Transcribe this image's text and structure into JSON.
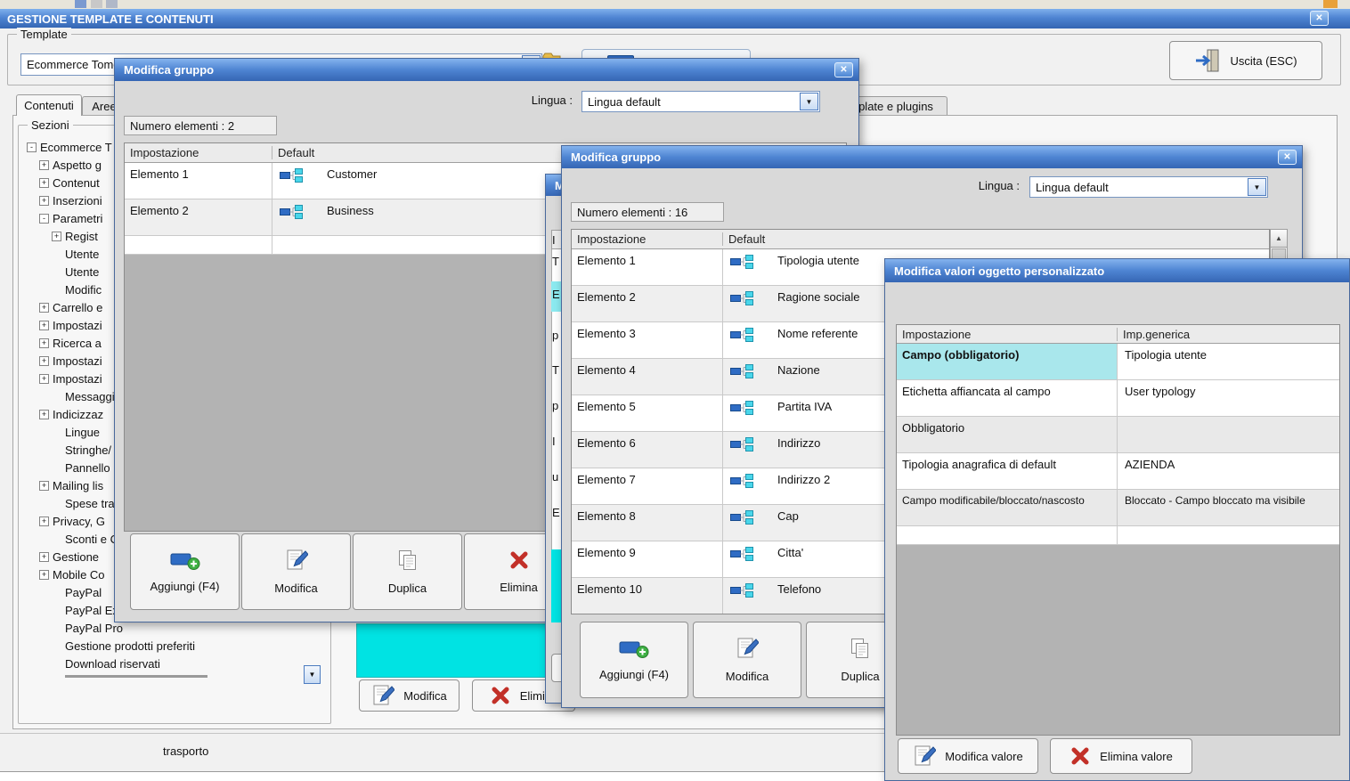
{
  "glyphs": {
    "close": "✕",
    "down": "▼",
    "up": "▲"
  },
  "app": {
    "title": "GESTIONE TEMPLATE E CONTENUTI"
  },
  "template_box": {
    "label": "Template",
    "combo_value": "Ecommerce Tome",
    "exit_button": "Uscita (ESC)"
  },
  "tabs": {
    "contenuti": "Contenuti",
    "aree": "Aree",
    "plugins": "plate e plugins"
  },
  "sezioni": {
    "label": "Sezioni",
    "tree": [
      {
        "exp": "-",
        "label": "Ecommerce T"
      },
      {
        "exp": "+",
        "label": "Aspetto g"
      },
      {
        "exp": "+",
        "label": "Contenut"
      },
      {
        "exp": "+",
        "label": "Inserzioni"
      },
      {
        "exp": "-",
        "label": "Parametri"
      },
      {
        "exp": "+",
        "label": "Regist"
      },
      {
        "label": "Utente"
      },
      {
        "label": "Utente"
      },
      {
        "label": "Modific"
      },
      {
        "exp": "+",
        "label": "Carrello e"
      },
      {
        "exp": "+",
        "label": "Impostazi"
      },
      {
        "exp": "+",
        "label": "Ricerca a"
      },
      {
        "exp": "+",
        "label": "Impostazi"
      },
      {
        "exp": "+",
        "label": "Impostazi"
      },
      {
        "label": "Messaggi"
      },
      {
        "exp": "+",
        "label": "Indicizzaz"
      },
      {
        "label": "Lingue"
      },
      {
        "label": "Stringhe/"
      },
      {
        "label": "Pannello"
      },
      {
        "exp": "+",
        "label": "Mailing lis"
      },
      {
        "label": "Spese tra"
      },
      {
        "exp": "+",
        "label": "Privacy, G"
      },
      {
        "label": "Sconti e C"
      },
      {
        "exp": "+",
        "label": "Gestione"
      },
      {
        "exp": "+",
        "label": "Mobile Co"
      },
      {
        "label": "PayPal"
      },
      {
        "label": "PayPal Ex"
      },
      {
        "label": "PayPal Pro"
      },
      {
        "label": "Gestione prodotti preferiti"
      },
      {
        "label": "Download riservati"
      }
    ]
  },
  "content": {
    "modifica_button": "Modifica",
    "elimina_button": "Elimina",
    "footer_text": "trasporto"
  },
  "dialog_a": {
    "title": "Modifica gruppo",
    "lingua_label": "Lingua :",
    "lingua_value": "Lingua default",
    "numero": "Numero elementi : 2",
    "col_impostazione": "Impostazione",
    "col_default": "Default",
    "rows": [
      {
        "name": "Elemento 1",
        "value": "Customer"
      },
      {
        "name": "Elemento 2",
        "value": "Business"
      }
    ],
    "btn_aggiungi": "Aggiungi (F4)",
    "btn_modifica": "Modifica",
    "btn_duplica": "Duplica",
    "btn_elimina": "Elimina"
  },
  "dialog_b": {
    "title": "Modifica gruppo",
    "lingua_label": "Lingua :",
    "lingua_value": "Lingua default",
    "numero": "Numero elementi : 16",
    "col_impostazione": "Impostazione",
    "col_default": "Default",
    "rows": [
      {
        "name": "Elemento 1",
        "value": "Tipologia utente"
      },
      {
        "name": "Elemento 2",
        "value": "Ragione sociale"
      },
      {
        "name": "Elemento 3",
        "value": "Nome referente"
      },
      {
        "name": "Elemento 4",
        "value": "Nazione"
      },
      {
        "name": "Elemento 5",
        "value": "Partita IVA"
      },
      {
        "name": "Elemento 6",
        "value": "Indirizzo"
      },
      {
        "name": "Elemento 7",
        "value": "Indirizzo 2"
      },
      {
        "name": "Elemento 8",
        "value": "Cap"
      },
      {
        "name": "Elemento 9",
        "value": "Citta'"
      },
      {
        "name": "Elemento 10",
        "value": "Telefono"
      }
    ],
    "btn_aggiungi": "Aggiungi (F4)",
    "btn_modifica": "Modifica",
    "btn_duplica": "Duplica"
  },
  "dialog_hidden": {
    "title_fragment": "M",
    "fragments": [
      "I",
      "T",
      "E",
      "p",
      "T",
      "p",
      "I",
      "u",
      "E"
    ]
  },
  "dialog_d": {
    "title": "Modifica valori oggetto personalizzato",
    "col_impostazione": "Impostazione",
    "col_generica": "Imp.generica",
    "rows": [
      {
        "name": "Campo (obbligatorio)",
        "value": "Tipologia utente"
      },
      {
        "name": "Etichetta affiancata al campo",
        "value": "User typology"
      },
      {
        "name": "Obbligatorio",
        "value": ""
      },
      {
        "name": "Tipologia anagrafica di default",
        "value": "AZIENDA"
      },
      {
        "name": "Campo modificabile/bloccato/nascosto",
        "value": "Bloccato - Campo bloccato ma visibile"
      }
    ],
    "btn_modifica": "Modifica valore",
    "btn_elimina": "Elimina valore"
  },
  "colors": {
    "titlebar_blue": "#4e84d2",
    "cyan_highlight": "#00e3e3",
    "cyan_cell": "#a9e7ec",
    "delete_red": "#c23028"
  }
}
